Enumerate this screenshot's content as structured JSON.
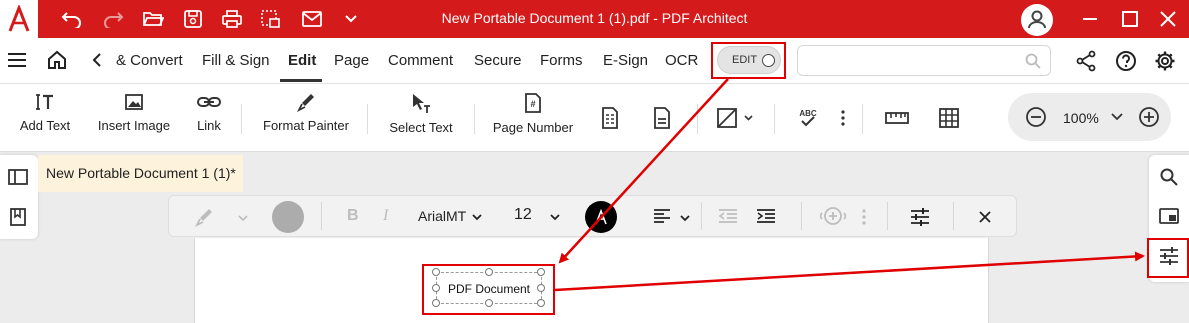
{
  "titlebar": {
    "title": "New Portable Document 1 (1).pdf  -  PDF Architect",
    "quick_access": [
      "undo-icon",
      "redo-icon",
      "open-folder-icon",
      "save-icon",
      "print-icon",
      "scan-icon",
      "email-icon",
      "chevron-down-icon"
    ],
    "window_controls": [
      "minimize-icon",
      "maximize-icon",
      "close-icon"
    ]
  },
  "menubar": {
    "tabs": [
      "& Convert",
      "Fill & Sign",
      "Edit",
      "Page",
      "Comment",
      "Secure",
      "Forms",
      "E-Sign",
      "OCR"
    ],
    "active_tab": "Edit",
    "edit_toggle": "EDIT",
    "search_placeholder": ""
  },
  "ribbon": {
    "add_text": "Add Text",
    "insert_image": "Insert Image",
    "link": "Link",
    "format_painter": "Format Painter",
    "select_text": "Select Text",
    "page_number": "Page Number",
    "zoom": "100%"
  },
  "document": {
    "tab_title": "New Portable Document 1 (1)*",
    "textbox_text": "PDF Document"
  },
  "format_toolbar": {
    "font": "ArialMT",
    "size": "12",
    "color_swatch": "#000000"
  },
  "colors": {
    "brand_red": "#d41a1a",
    "highlight": "#e00000",
    "doc_tab_bg": "#fdf2dc"
  }
}
